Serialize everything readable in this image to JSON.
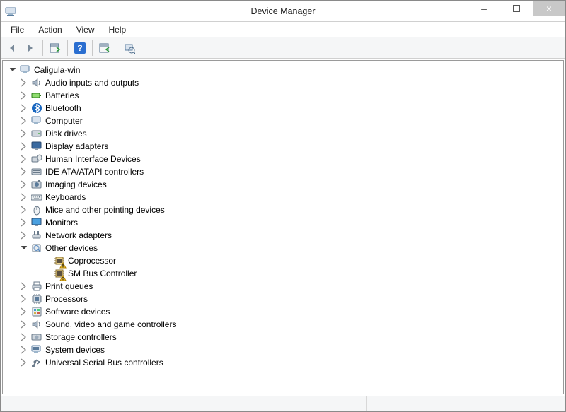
{
  "window": {
    "title": "Device Manager"
  },
  "menubar": {
    "file": "File",
    "action": "Action",
    "view": "View",
    "help": "Help"
  },
  "toolbar": {
    "back": "back-icon",
    "forward": "forward-icon",
    "show_hide": "show-hide-tree-icon",
    "help": "help-icon",
    "action": "properties-icon",
    "scan": "scan-hardware-icon"
  },
  "tree": {
    "root": "Caligula-win",
    "nodes": [
      {
        "icon": "speaker",
        "label": "Audio inputs and outputs"
      },
      {
        "icon": "battery",
        "label": "Batteries"
      },
      {
        "icon": "bluetooth",
        "label": "Bluetooth"
      },
      {
        "icon": "computer",
        "label": "Computer"
      },
      {
        "icon": "disk",
        "label": "Disk drives"
      },
      {
        "icon": "display",
        "label": "Display adapters"
      },
      {
        "icon": "hid",
        "label": "Human Interface Devices"
      },
      {
        "icon": "ide",
        "label": "IDE ATA/ATAPI controllers"
      },
      {
        "icon": "imaging",
        "label": "Imaging devices"
      },
      {
        "icon": "keyboard",
        "label": "Keyboards"
      },
      {
        "icon": "mouse",
        "label": "Mice and other pointing devices"
      },
      {
        "icon": "monitor",
        "label": "Monitors"
      },
      {
        "icon": "network",
        "label": "Network adapters"
      },
      {
        "icon": "other",
        "label": "Other devices",
        "expanded": true,
        "children": [
          {
            "icon": "chip-warn",
            "label": "Coprocessor"
          },
          {
            "icon": "chip-warn",
            "label": "SM Bus Controller"
          }
        ]
      },
      {
        "icon": "printer",
        "label": "Print queues"
      },
      {
        "icon": "cpu",
        "label": "Processors"
      },
      {
        "icon": "software",
        "label": "Software devices"
      },
      {
        "icon": "speaker",
        "label": "Sound, video and game controllers"
      },
      {
        "icon": "storage",
        "label": "Storage controllers"
      },
      {
        "icon": "system",
        "label": "System devices"
      },
      {
        "icon": "usb",
        "label": "Universal Serial Bus controllers"
      }
    ]
  }
}
